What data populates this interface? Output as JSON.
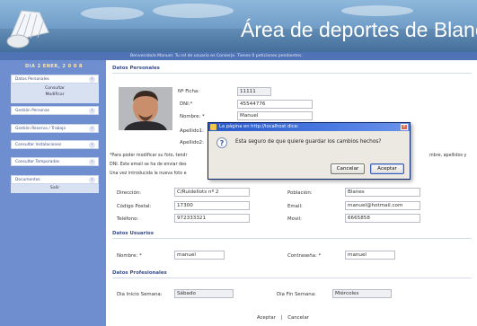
{
  "header": {
    "title": "Área de deportes de Blanes",
    "welcome": "Benvenido/a Manuel. Tu rol de usuario es Conserje. Tienes 0 peticiones pendientes."
  },
  "sidebar": {
    "date": "DIA 2 ENER, 2 0 0 8",
    "items": [
      {
        "label": "Datos Personales"
      },
      {
        "label": "Gestión Personas"
      },
      {
        "label": "Gestión Reserva / Trabajo"
      },
      {
        "label": "Consultar Instalaciones"
      },
      {
        "label": "Consultar Temporadas"
      },
      {
        "label": "Documentos"
      }
    ],
    "sub_consultar": "Consultar",
    "sub_modificar": "Modificar",
    "sub_salir": "Salir"
  },
  "personal": {
    "section_title": "Datos Personales",
    "ficha_label": "Nº Ficha:",
    "ficha_value": "11111",
    "dni_label": "DNI:*",
    "dni_value": "45544776",
    "nombre_label": "Nombre: *",
    "nombre_value": "Manuel",
    "apellido1_label": "Apellido1:",
    "apellido2_label": "Apellido2:",
    "info_line1": "*Para poder modificar su foto, tendr",
    "info_line1_end": "mbre, apellidos y",
    "info_line2": "DNI. Este email se ha de enviar des",
    "info_line3": "Una vez introducida la nueva foto e",
    "direccion_label": "Dirección:",
    "direccion_value": "C/Ruidellots nº 2",
    "poblacion_label": "Población:",
    "poblacion_value": "Blanes",
    "cp_label": "Código Postal:",
    "cp_value": "17300",
    "email_label": "Email:",
    "email_value": "manuel@hotmail.com",
    "telefono_label": "Teléfono:",
    "telefono_value": "972333321",
    "movil_label": "Movil:",
    "movil_value": "6665858"
  },
  "usuarios": {
    "section_title": "Datos Usuarios",
    "nombre_label": "Nombre: *",
    "nombre_value": "manuel",
    "pass_label": "Contraseña: *",
    "pass_value": "manuel"
  },
  "profesionales": {
    "section_title": "Datos Profesionales",
    "inicio_label": "Dia Inicio Semana:",
    "inicio_value": "Sábado",
    "fin_label": "Dia Fin Semana:",
    "fin_value": "Miércoles"
  },
  "bottom": {
    "aceptar": "Aceptar",
    "separator": "|",
    "cancelar": "Cancelar"
  },
  "dialog": {
    "title": "La página en http://localhost dice:",
    "message": "Esta seguro de que quiere guardar los cambios hechos?",
    "cancel_label": "Cancelar",
    "accept_label": "Aceptar",
    "icon": "question-icon"
  }
}
